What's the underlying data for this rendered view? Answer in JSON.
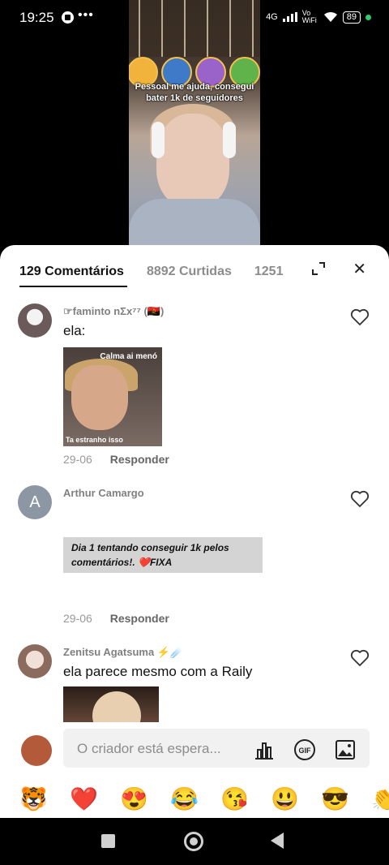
{
  "status": {
    "time": "19:25",
    "network": "4G",
    "volte": "Vo WiFi",
    "battery": "89"
  },
  "video": {
    "caption": "Pessoal me ajuda, consegui bater 1k de seguidores"
  },
  "tabs": {
    "comments": "129 Comentários",
    "likes": "8892 Curtidas",
    "shares": "1251"
  },
  "comments": [
    {
      "name": "☞faminto nΣx⁷⁷ (🇦🇴)",
      "text": "ela:",
      "image_top": "Calma ai menó",
      "image_bottom": "Ta estranho isso",
      "date": "29-06",
      "reply": "Responder"
    },
    {
      "name": "Arthur Camargo",
      "avatar_letter": "A",
      "banner_line1": "Dia 1 tentando conseguir 1k pelos",
      "banner_line2": "comentários!. ❤️FIXA",
      "date": "29-06",
      "reply": "Responder"
    },
    {
      "name": "Zenitsu Agatsuma ⚡☄️",
      "text": "ela parece mesmo com a Raily"
    }
  ],
  "input": {
    "placeholder": "O criador está espera..."
  },
  "emoji_bar": [
    "🐯",
    "❤️",
    "😍",
    "😂",
    "😘",
    "😃",
    "😎",
    "👏"
  ]
}
